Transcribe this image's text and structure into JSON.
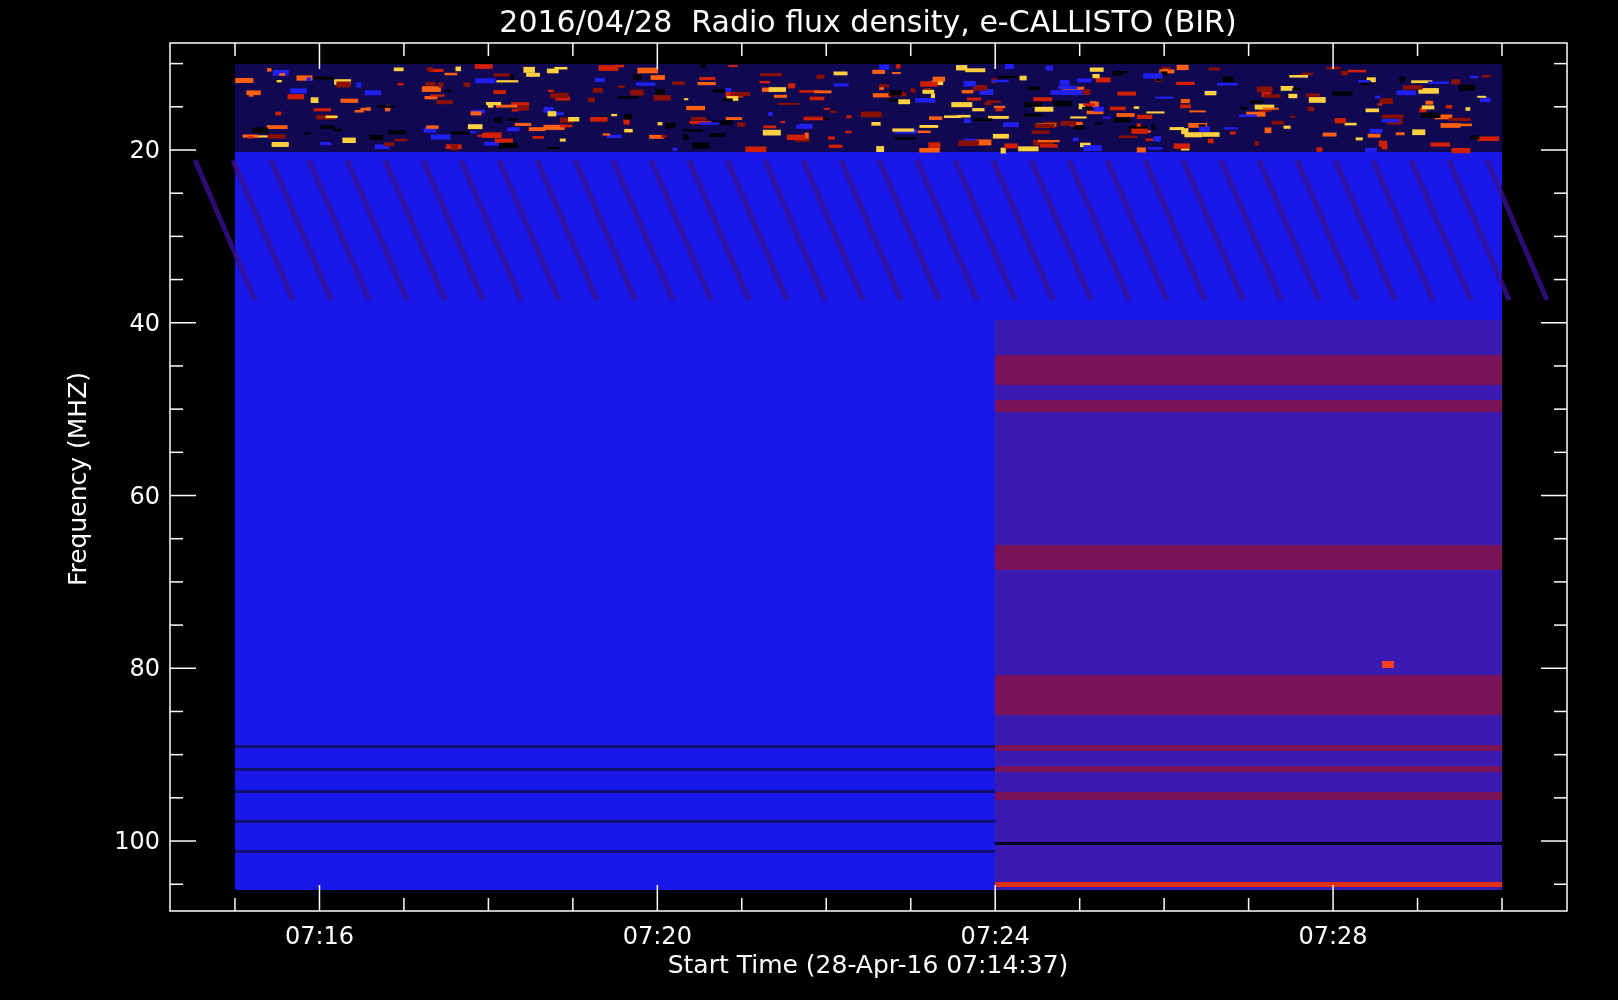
{
  "title": "2016/04/28  Radio flux density, e-CALLISTO (BIR)",
  "y_axis": {
    "label": "Frequency (MHZ)",
    "ticks": [
      "20",
      "40",
      "60",
      "80",
      "100"
    ]
  },
  "x_axis": {
    "label": "Start Time (28-Apr-16 07:14:37)",
    "ticks": [
      "07:16",
      "07:20",
      "07:24",
      "07:28"
    ]
  }
}
